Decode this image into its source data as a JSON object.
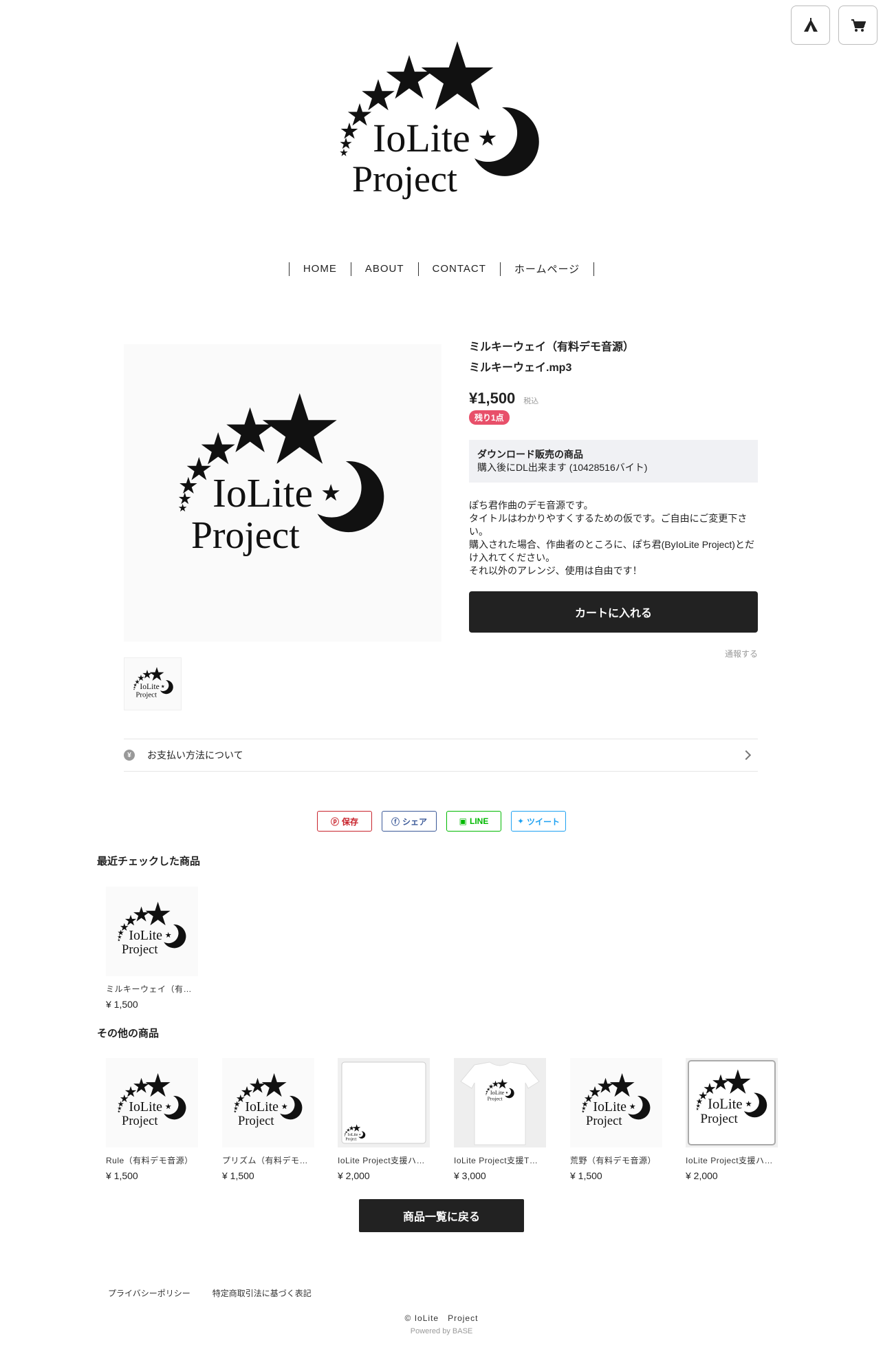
{
  "header": {
    "icons": [
      "tent-icon",
      "cart-icon"
    ]
  },
  "logo": {
    "line1": "IoLite",
    "line2": "Project"
  },
  "nav": {
    "items": [
      "HOME",
      "ABOUT",
      "CONTACT",
      "ホームページ"
    ]
  },
  "product": {
    "title_line1": "ミルキーウェイ（有料デモ音源）",
    "title_line2": "ミルキーウェイ.mp3",
    "price": "¥1,500",
    "tax_label": "税込",
    "stock_badge": "残り1点",
    "download_title": "ダウンロード販売の商品",
    "download_note": "購入後にDL出来ます (10428516バイト)",
    "description": "ぽち君作曲のデモ音源です。\nタイトルはわかりやすくするための仮です。ご自由にご変更下さい。\n購入された場合、作曲者のところに、ぽち君(ByIoLite Project)とだけ入れてください。\nそれ以外のアレンジ、使用は自由です！",
    "cart_button": "カートに入れる",
    "report_link": "通報する"
  },
  "payment": {
    "icon": "yen-icon",
    "label": "お支払い方法について"
  },
  "share": {
    "pinterest": "保存",
    "facebook": "シェア",
    "line": "LINE",
    "twitter": "ツイート",
    "colors": {
      "pinterest": "#c8232c",
      "facebook": "#3b5998",
      "line": "#00b900",
      "twitter": "#1da1f2"
    }
  },
  "recent": {
    "title": "最近チェックした商品",
    "items": [
      {
        "name": "ミルキーウェイ（有…",
        "price": "¥ 1,500"
      }
    ]
  },
  "others": {
    "title": "その他の商品",
    "items": [
      {
        "name": "Rule（有料デモ音源）",
        "price": "¥ 1,500"
      },
      {
        "name": "プリズム（有料デモ…",
        "price": "¥ 1,500"
      },
      {
        "name": "IoLite Project支援ハ…",
        "price": "¥ 2,000"
      },
      {
        "name": "IoLite Project支援T…",
        "price": "¥ 3,000"
      },
      {
        "name": "荒野（有料デモ音源）",
        "price": "¥ 1,500"
      },
      {
        "name": "IoLite Project支援ハ…",
        "price": "¥ 2,000"
      }
    ]
  },
  "back_button": "商品一覧に戻る",
  "footer": {
    "privacy": "プライバシーポリシー",
    "legal": "特定商取引法に基づく表記",
    "copyright": "© IoLite　Project",
    "powered": "Powered by BASE"
  }
}
